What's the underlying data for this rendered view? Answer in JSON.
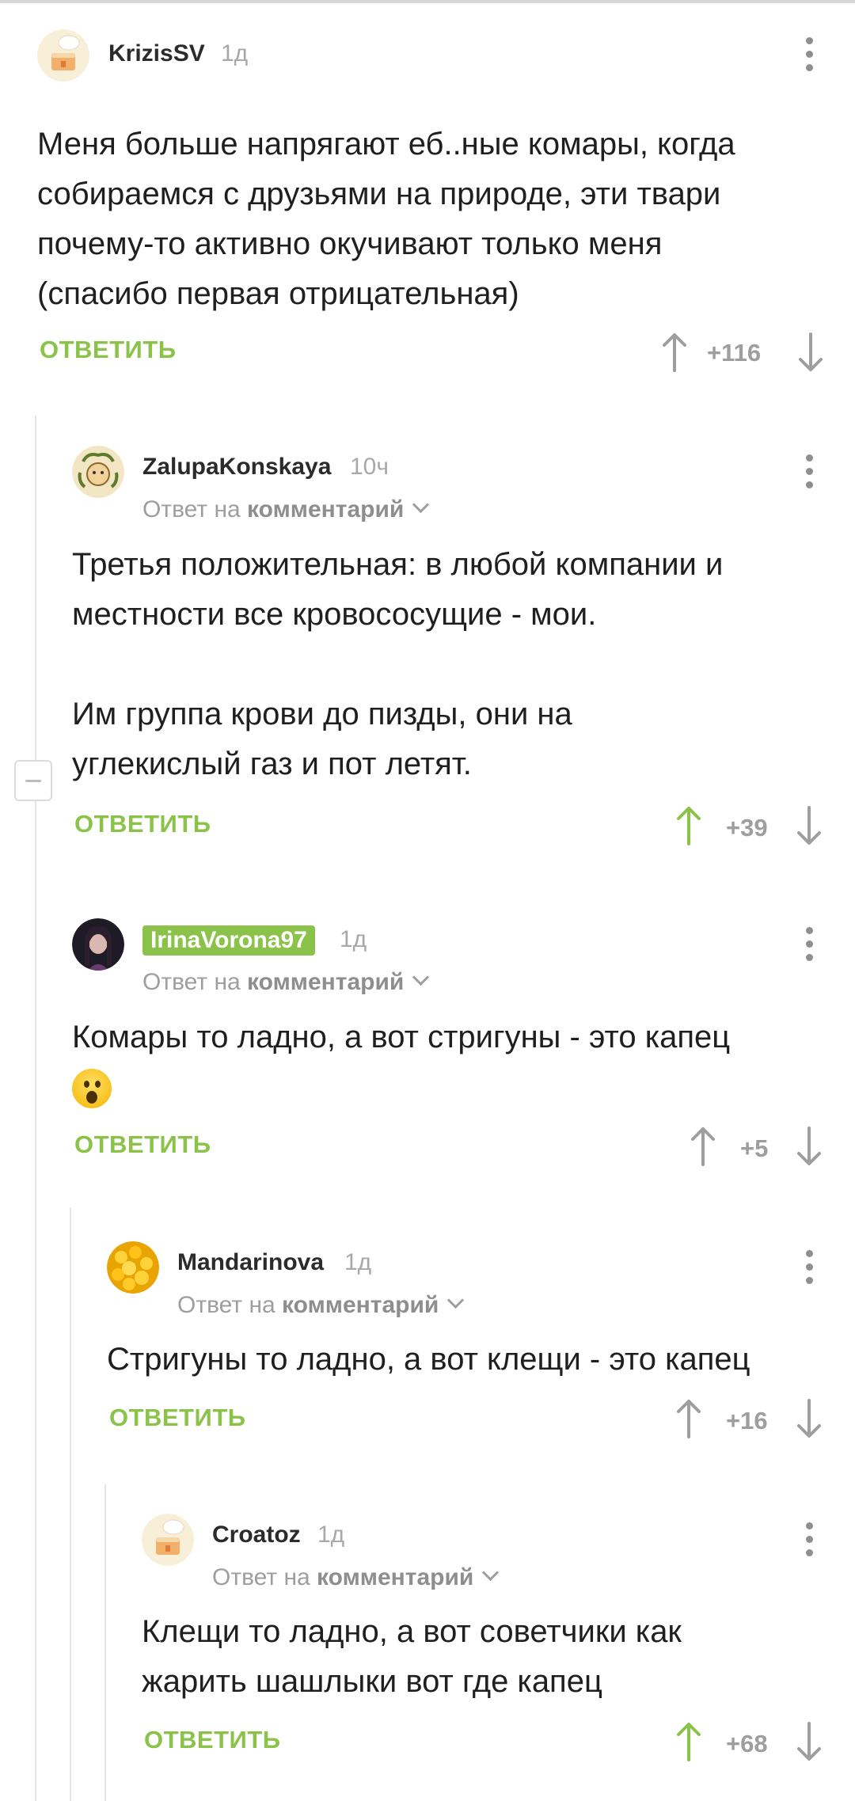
{
  "ui": {
    "reply_label": "ОТВЕТИТЬ",
    "reply_to_prefix": "Ответ на",
    "reply_to_target": "комментарий"
  },
  "colors": {
    "accent": "#8bc34a",
    "muted": "#9e9e9e",
    "text": "#1f1f1f"
  },
  "comments": [
    {
      "author": "KrizisSV",
      "time": "1д",
      "lines": [
        "Меня больше напрягают еб..ные комары, когда",
        "собираемся с друзьями на природе, эти твари",
        "почему-то активно окучивают только меня",
        "(спасибо первая отрицательная)"
      ],
      "score": "+116",
      "upvoted": false
    },
    {
      "author": "ZalupaKonskaya",
      "time": "10ч",
      "lines": [
        "Третья положительная: в любой компании и",
        "местности все кровососущие - мои.",
        "",
        "Им группа крови до пизды, они на",
        "углекислый газ и пот летят."
      ],
      "score": "+39",
      "upvoted": true
    },
    {
      "author": "IrinaVorona97",
      "time": "1д",
      "lines": [
        "Комары то ладно, а вот стригуны - это капец"
      ],
      "emoji": "scream-emoji",
      "score": "+5",
      "upvoted": false
    },
    {
      "author": "Mandarinova",
      "time": "1д",
      "lines": [
        "Стригуны то ладно, а вот клещи - это капец"
      ],
      "score": "+16",
      "upvoted": false
    },
    {
      "author": "Croatoz",
      "time": "1д",
      "lines": [
        "Клещи то ладно, а вот советчики как",
        "жарить шашлыки вот где капец"
      ],
      "score": "+68",
      "upvoted": true
    }
  ]
}
